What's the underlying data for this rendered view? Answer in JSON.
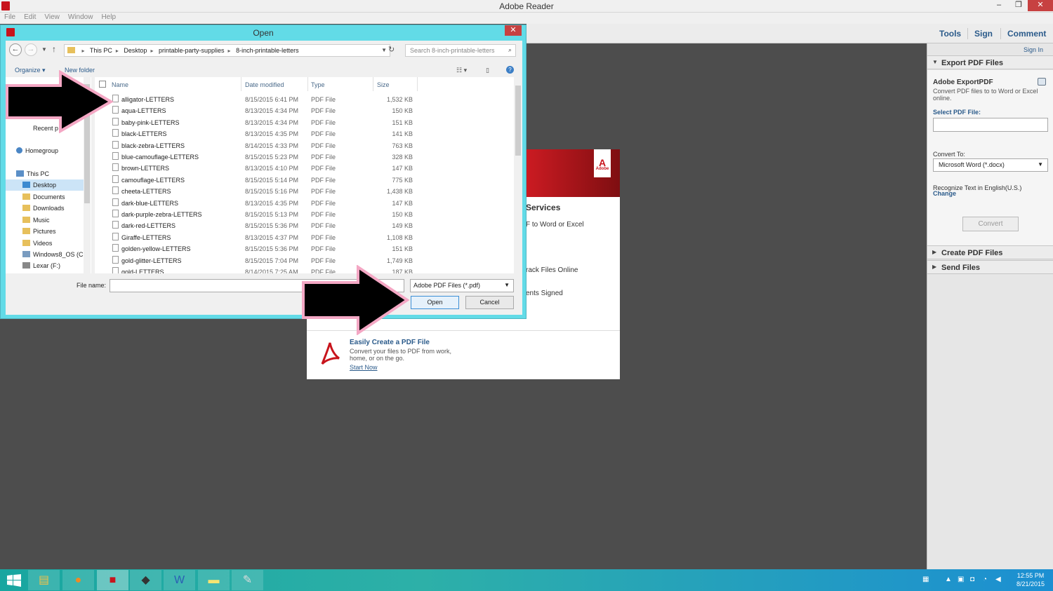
{
  "app": {
    "title": "Adobe Reader",
    "menu": [
      "File",
      "Edit",
      "View",
      "Window",
      "Help"
    ],
    "window_buttons": {
      "minimize": "–",
      "restore": "❐",
      "close": "✕"
    }
  },
  "toolbar": {
    "tools": "Tools",
    "sign": "Sign",
    "comment": "Comment"
  },
  "right_pane": {
    "sign_in": "Sign In",
    "export_section": "Export PDF Files",
    "export_heading": "Adobe ExportPDF",
    "export_desc": "Convert PDF files to to Word or Excel online.",
    "select_label": "Select PDF File:",
    "convert_to_label": "Convert To:",
    "convert_to_value": "Microsoft Word (*.docx)",
    "recognize_text": "Recognize Text in English(U.S.)",
    "change_link": "Change",
    "convert_button": "Convert",
    "create_section": "Create PDF Files",
    "send_section": "Send Files"
  },
  "welcome": {
    "logo_text": "A",
    "logo_sub": "Adobe",
    "services_heading": "Services",
    "line1": "F to Word or Excel",
    "line2": "rack Files Online",
    "line3": "ents Signed",
    "create_heading": "Easily Create a PDF File",
    "create_desc": "Convert your files to PDF from work, home, or on the go.",
    "start_now": "Start Now"
  },
  "dialog": {
    "title": "Open",
    "close": "✕",
    "breadcrumb": [
      "This PC",
      "Desktop",
      "printable-party-supplies",
      "8-inch-printable-letters"
    ],
    "search_placeholder": "Search 8-inch-printable-letters",
    "organize": "Organize ▾",
    "new_folder": "New folder",
    "nav_items": [
      {
        "label": "Recent p"
      },
      {
        "label": "Homegroup"
      },
      {
        "label": "This PC"
      },
      {
        "label": "Desktop"
      },
      {
        "label": "Documents"
      },
      {
        "label": "Downloads"
      },
      {
        "label": "Music"
      },
      {
        "label": "Pictures"
      },
      {
        "label": "Videos"
      },
      {
        "label": "Windows8_OS (C"
      },
      {
        "label": "Lexar (F:)"
      }
    ],
    "columns": {
      "name": "Name",
      "date": "Date modified",
      "type": "Type",
      "size": "Size"
    },
    "files": [
      {
        "name": "alligator-LETTERS",
        "date": "8/15/2015 6:41 PM",
        "type": "PDF File",
        "size": "1,532 KB"
      },
      {
        "name": "aqua-LETTERS",
        "date": "8/13/2015 4:34 PM",
        "type": "PDF File",
        "size": "150 KB"
      },
      {
        "name": "baby-pink-LETTERS",
        "date": "8/13/2015 4:34 PM",
        "type": "PDF File",
        "size": "151 KB"
      },
      {
        "name": "black-LETTERS",
        "date": "8/13/2015 4:35 PM",
        "type": "PDF File",
        "size": "141 KB"
      },
      {
        "name": "black-zebra-LETTERS",
        "date": "8/14/2015 4:33 PM",
        "type": "PDF File",
        "size": "763 KB"
      },
      {
        "name": "blue-camouflage-LETTERS",
        "date": "8/15/2015 5:23 PM",
        "type": "PDF File",
        "size": "328 KB"
      },
      {
        "name": "brown-LETTERS",
        "date": "8/13/2015 4:10 PM",
        "type": "PDF File",
        "size": "147 KB"
      },
      {
        "name": "camouflage-LETTERS",
        "date": "8/15/2015 5:14 PM",
        "type": "PDF File",
        "size": "775 KB"
      },
      {
        "name": "cheeta-LETTERS",
        "date": "8/15/2015 5:16 PM",
        "type": "PDF File",
        "size": "1,438 KB"
      },
      {
        "name": "dark-blue-LETTERS",
        "date": "8/13/2015 4:35 PM",
        "type": "PDF File",
        "size": "147 KB"
      },
      {
        "name": "dark-purple-zebra-LETTERS",
        "date": "8/15/2015 5:13 PM",
        "type": "PDF File",
        "size": "150 KB"
      },
      {
        "name": "dark-red-LETTERS",
        "date": "8/15/2015 5:36 PM",
        "type": "PDF File",
        "size": "149 KB"
      },
      {
        "name": "Giraffe-LETTERS",
        "date": "8/13/2015 4:37 PM",
        "type": "PDF File",
        "size": "1,108 KB"
      },
      {
        "name": "golden-yellow-LETTERS",
        "date": "8/15/2015 5:36 PM",
        "type": "PDF File",
        "size": "151 KB"
      },
      {
        "name": "gold-glitter-LETTERS",
        "date": "8/15/2015 7:04 PM",
        "type": "PDF File",
        "size": "1,749 KB"
      },
      {
        "name": "gold-LETTERS",
        "date": "8/14/2015 7:25 AM",
        "type": "PDF File",
        "size": "187 KB"
      }
    ],
    "file_name_label": "File name:",
    "file_name_value": "",
    "file_type": "Adobe PDF Files (*.pdf)",
    "open_button": "Open",
    "cancel_button": "Cancel"
  },
  "taskbar": {
    "time": "12:55 PM",
    "date": "8/21/2015"
  },
  "colors": {
    "dialog_frame": "#62dbe7",
    "adobe_red": "#c8141c",
    "arrow_border": "#f4a7c4"
  }
}
